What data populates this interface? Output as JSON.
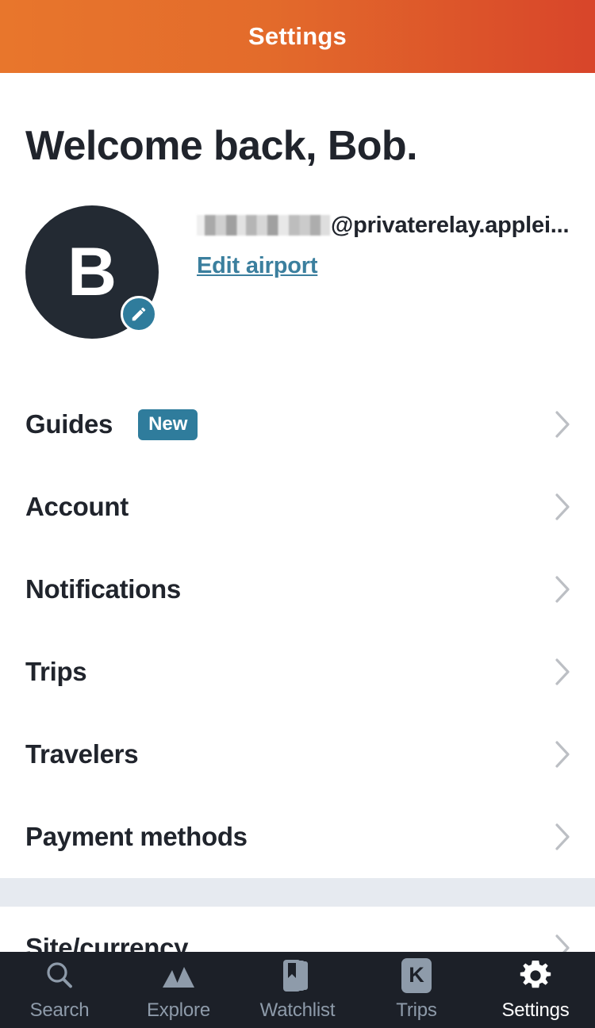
{
  "header": {
    "title": "Settings"
  },
  "welcome": {
    "greeting": "Welcome back, Bob."
  },
  "profile": {
    "avatar_initial": "B",
    "email_suffix": "@privaterelay.applei...",
    "edit_link": "Edit airport",
    "edit_badge_icon": "pencil-icon",
    "redacted_label": "redacted-email"
  },
  "settings": {
    "rows": [
      {
        "label": "Guides",
        "badge": "New"
      },
      {
        "label": "Account",
        "badge": ""
      },
      {
        "label": "Notifications",
        "badge": ""
      },
      {
        "label": "Trips",
        "badge": ""
      },
      {
        "label": "Travelers",
        "badge": ""
      },
      {
        "label": "Payment methods",
        "badge": ""
      },
      {
        "label": "Site/currency",
        "badge": ""
      }
    ]
  },
  "tabbar": {
    "items": [
      {
        "label": "Search",
        "icon": "search-icon",
        "active": false
      },
      {
        "label": "Explore",
        "icon": "mountains-icon",
        "active": false
      },
      {
        "label": "Watchlist",
        "icon": "bookmark-cards-icon",
        "active": false
      },
      {
        "label": "Trips",
        "icon": "kayak-k-icon",
        "active": false
      },
      {
        "label": "Settings",
        "icon": "gear-icon",
        "active": true
      }
    ],
    "trips_icon_letter": "K"
  },
  "colors": {
    "header_gradient_start": "#e8762c",
    "header_gradient_end": "#d8452a",
    "accent_teal": "#2f7c9c",
    "link_teal": "#3b7f9e",
    "dark_navy": "#1c2028",
    "section_divider": "#e6eaf0",
    "tab_inactive": "#8e9baa"
  }
}
